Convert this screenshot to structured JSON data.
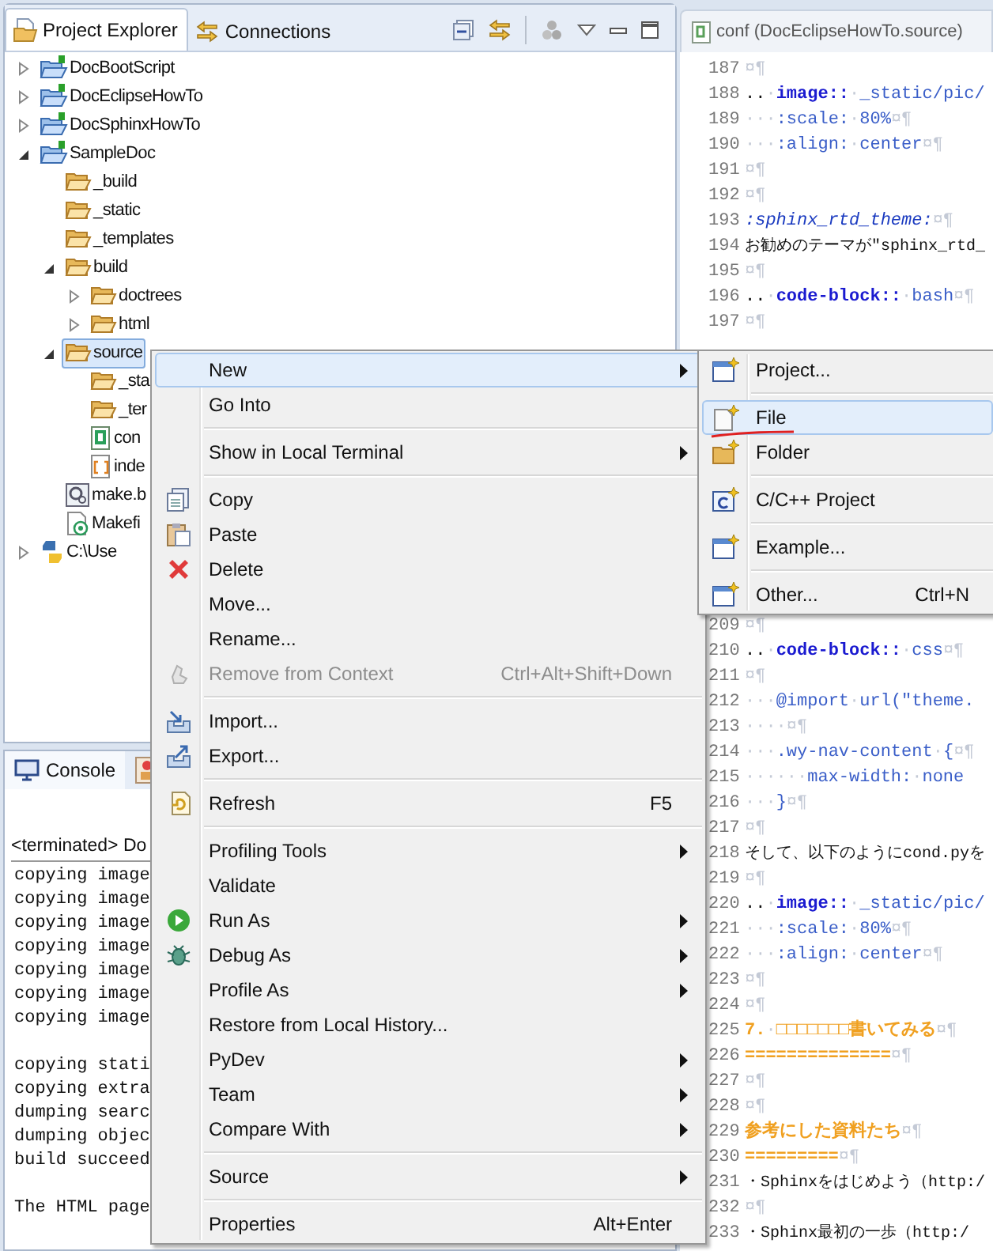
{
  "explorer": {
    "tabs": [
      {
        "label": "Project Explorer",
        "selected": true
      },
      {
        "label": "Connections",
        "selected": false
      }
    ],
    "tree": [
      {
        "label": "DocBootScript",
        "kind": "project",
        "expanded": false,
        "selected": false
      },
      {
        "label": "DocEclipseHowTo",
        "kind": "project",
        "expanded": false,
        "selected": false
      },
      {
        "label": "DocSphinxHowTo",
        "kind": "project",
        "expanded": false,
        "selected": false
      },
      {
        "label": "SampleDoc",
        "kind": "project",
        "expanded": true,
        "selected": false,
        "children": [
          {
            "label": "_build",
            "kind": "folder",
            "selected": false
          },
          {
            "label": "_static",
            "kind": "folder",
            "selected": false
          },
          {
            "label": "_templates",
            "kind": "folder",
            "selected": false
          },
          {
            "label": "build",
            "kind": "folder",
            "expanded": true,
            "selected": false,
            "children": [
              {
                "label": "doctrees",
                "kind": "folder",
                "expanded": false,
                "selected": false
              },
              {
                "label": "html",
                "kind": "folder",
                "expanded": false,
                "selected": false
              }
            ]
          },
          {
            "label": "source",
            "kind": "folder",
            "expanded": true,
            "selected": true,
            "children": [
              {
                "label": "_sta",
                "kind": "folder",
                "selected": false
              },
              {
                "label": "_ter",
                "kind": "folder",
                "selected": false
              },
              {
                "label": "con",
                "kind": "pyfile",
                "selected": false
              },
              {
                "label": "inde",
                "kind": "rstfile",
                "selected": false
              }
            ]
          },
          {
            "label": "make.b",
            "kind": "batfile",
            "selected": false
          },
          {
            "label": "Makefi",
            "kind": "makefile",
            "selected": false
          }
        ]
      },
      {
        "label": "C:\\Use",
        "kind": "python",
        "expanded": false,
        "selected": false
      }
    ]
  },
  "console": {
    "tabs": [
      {
        "label": "Console",
        "selected": true
      }
    ],
    "header": "<terminated> Do",
    "line_groups": [
      [
        "copying image",
        "copying image",
        "copying image",
        "copying image",
        "copying image",
        "copying image",
        "copying image"
      ],
      [
        "copying stati",
        "copying extra",
        "dumping searc",
        "dumping objec",
        "build succeed"
      ],
      [
        "The HTML page"
      ]
    ]
  },
  "editor": {
    "tab": {
      "label": "conf (DocEclipseHowTo.source)"
    },
    "lines_top": [
      {
        "n": "187",
        "parts": [
          {
            "text": "¤¶",
            "kind": "ws"
          }
        ]
      },
      {
        "n": "188",
        "parts": [
          {
            "text": "..",
            "kind": "plain"
          },
          {
            "text": "·",
            "kind": "ws"
          },
          {
            "text": "image::",
            "kind": "directive"
          },
          {
            "text": "·",
            "kind": "ws"
          },
          {
            "text": "_static/pic/",
            "kind": "value"
          }
        ]
      },
      {
        "n": "189",
        "parts": [
          {
            "text": "···",
            "kind": "ws"
          },
          {
            "text": ":scale:",
            "kind": "value"
          },
          {
            "text": "·",
            "kind": "ws"
          },
          {
            "text": "80%",
            "kind": "value"
          },
          {
            "text": "¤¶",
            "kind": "ws"
          }
        ]
      },
      {
        "n": "190",
        "parts": [
          {
            "text": "···",
            "kind": "ws"
          },
          {
            "text": ":align:",
            "kind": "value"
          },
          {
            "text": "·",
            "kind": "ws"
          },
          {
            "text": "center",
            "kind": "value"
          },
          {
            "text": "¤¶",
            "kind": "ws"
          }
        ]
      },
      {
        "n": "191",
        "parts": [
          {
            "text": "¤¶",
            "kind": "ws"
          }
        ]
      },
      {
        "n": "192",
        "parts": [
          {
            "text": "¤¶",
            "kind": "ws"
          }
        ]
      },
      {
        "n": "193",
        "parts": [
          {
            "text": ":sphinx_rtd_theme:",
            "kind": "role"
          },
          {
            "text": "¤¶",
            "kind": "ws"
          }
        ]
      },
      {
        "n": "194",
        "parts": [
          {
            "text": "お勧めのテーマが\"sphinx_rtd_",
            "kind": "prose"
          }
        ]
      },
      {
        "n": "195",
        "parts": [
          {
            "text": "¤¶",
            "kind": "ws"
          }
        ]
      },
      {
        "n": "196",
        "parts": [
          {
            "text": "..",
            "kind": "plain"
          },
          {
            "text": "·",
            "kind": "ws"
          },
          {
            "text": "code-block::",
            "kind": "directive"
          },
          {
            "text": "·",
            "kind": "ws"
          },
          {
            "text": "bash",
            "kind": "value"
          },
          {
            "text": "¤¶",
            "kind": "ws"
          }
        ]
      },
      {
        "n": "197",
        "parts": [
          {
            "text": "¤¶",
            "kind": "ws"
          }
        ]
      }
    ],
    "lines_bottom": [
      {
        "n": "209",
        "parts": [
          {
            "text": "¤¶",
            "kind": "ws"
          }
        ]
      },
      {
        "n": "210",
        "parts": [
          {
            "text": "..",
            "kind": "plain"
          },
          {
            "text": "·",
            "kind": "ws"
          },
          {
            "text": "code-block::",
            "kind": "directive"
          },
          {
            "text": "·",
            "kind": "ws"
          },
          {
            "text": "css",
            "kind": "value"
          },
          {
            "text": "¤¶",
            "kind": "ws"
          }
        ]
      },
      {
        "n": "211",
        "parts": [
          {
            "text": "¤¶",
            "kind": "ws"
          }
        ]
      },
      {
        "n": "212",
        "parts": [
          {
            "text": "···",
            "kind": "ws"
          },
          {
            "text": "@import",
            "kind": "value"
          },
          {
            "text": "·",
            "kind": "ws"
          },
          {
            "text": "url(\"theme.",
            "kind": "value"
          }
        ]
      },
      {
        "n": "213",
        "parts": [
          {
            "text": "····",
            "kind": "ws"
          },
          {
            "text": "¤¶",
            "kind": "ws"
          }
        ]
      },
      {
        "n": "214",
        "parts": [
          {
            "text": "···",
            "kind": "ws"
          },
          {
            "text": ".wy-nav-content",
            "kind": "value"
          },
          {
            "text": "·",
            "kind": "ws"
          },
          {
            "text": "{",
            "kind": "value"
          },
          {
            "text": "¤¶",
            "kind": "ws"
          }
        ]
      },
      {
        "n": "215",
        "parts": [
          {
            "text": "······",
            "kind": "ws"
          },
          {
            "text": "max-width:",
            "kind": "value"
          },
          {
            "text": "·",
            "kind": "ws"
          },
          {
            "text": "none",
            "kind": "value"
          }
        ]
      },
      {
        "n": "216",
        "parts": [
          {
            "text": "···",
            "kind": "ws"
          },
          {
            "text": "}",
            "kind": "value"
          },
          {
            "text": "¤¶",
            "kind": "ws"
          }
        ]
      },
      {
        "n": "217",
        "parts": [
          {
            "text": "¤¶",
            "kind": "ws"
          }
        ]
      },
      {
        "n": "218",
        "parts": [
          {
            "text": "そして、以下のようにcond.pyを",
            "kind": "prose"
          }
        ]
      },
      {
        "n": "219",
        "parts": [
          {
            "text": "¤¶",
            "kind": "ws"
          }
        ]
      },
      {
        "n": "220",
        "parts": [
          {
            "text": "..",
            "kind": "plain"
          },
          {
            "text": "·",
            "kind": "ws"
          },
          {
            "text": "image::",
            "kind": "directive"
          },
          {
            "text": "·",
            "kind": "ws"
          },
          {
            "text": "_static/pic/",
            "kind": "value"
          }
        ]
      },
      {
        "n": "221",
        "parts": [
          {
            "text": "···",
            "kind": "ws"
          },
          {
            "text": ":scale:",
            "kind": "value"
          },
          {
            "text": "·",
            "kind": "ws"
          },
          {
            "text": "80%",
            "kind": "value"
          },
          {
            "text": "¤¶",
            "kind": "ws"
          }
        ]
      },
      {
        "n": "222",
        "parts": [
          {
            "text": "···",
            "kind": "ws"
          },
          {
            "text": ":align:",
            "kind": "value"
          },
          {
            "text": "·",
            "kind": "ws"
          },
          {
            "text": "center",
            "kind": "value"
          },
          {
            "text": "¤¶",
            "kind": "ws"
          }
        ]
      },
      {
        "n": "223",
        "parts": [
          {
            "text": "¤¶",
            "kind": "ws"
          }
        ]
      },
      {
        "n": "224",
        "parts": [
          {
            "text": "¤¶",
            "kind": "ws"
          }
        ]
      },
      {
        "n": "225",
        "parts": [
          {
            "text": "7.",
            "kind": "heading"
          },
          {
            "text": "·",
            "kind": "ws"
          },
          {
            "text": "□□□□□□□書いてみる",
            "kind": "heading"
          },
          {
            "text": "¤¶",
            "kind": "ws"
          }
        ]
      },
      {
        "n": "226",
        "parts": [
          {
            "text": "==============",
            "kind": "heading"
          },
          {
            "text": "¤¶",
            "kind": "ws"
          }
        ]
      },
      {
        "n": "227",
        "parts": [
          {
            "text": "¤¶",
            "kind": "ws"
          }
        ]
      },
      {
        "n": "228",
        "parts": [
          {
            "text": "¤¶",
            "kind": "ws"
          }
        ]
      },
      {
        "n": "229",
        "parts": [
          {
            "text": "参考にした資料たち",
            "kind": "heading"
          },
          {
            "text": "¤¶",
            "kind": "ws"
          }
        ]
      },
      {
        "n": "230",
        "parts": [
          {
            "text": "=========",
            "kind": "heading"
          },
          {
            "text": "¤¶",
            "kind": "ws"
          }
        ]
      },
      {
        "n": "231",
        "parts": [
          {
            "text": "・Sphinxをはじめよう（http:/",
            "kind": "prose"
          }
        ]
      },
      {
        "n": "232",
        "parts": [
          {
            "text": "¤¶",
            "kind": "ws"
          }
        ]
      },
      {
        "n": "233",
        "parts": [
          {
            "text": "・Sphinx最初の一歩（http:/",
            "kind": "prose"
          }
        ]
      }
    ]
  },
  "context_menu": {
    "items": [
      {
        "kind": "item",
        "label": "New",
        "submenu": true,
        "selected": true,
        "disabled": false
      },
      {
        "kind": "item",
        "label": "Go Into",
        "selected": false,
        "disabled": false
      },
      {
        "kind": "separator"
      },
      {
        "kind": "item",
        "label": "Show in Local Terminal",
        "submenu": true,
        "selected": false,
        "disabled": false
      },
      {
        "kind": "separator"
      },
      {
        "kind": "copy",
        "label": "Copy",
        "selected": false,
        "disabled": false
      },
      {
        "kind": "paste",
        "label": "Paste",
        "selected": false,
        "disabled": false
      },
      {
        "kind": "delete",
        "label": "Delete",
        "selected": false,
        "disabled": false
      },
      {
        "kind": "item",
        "label": "Move...",
        "selected": false,
        "disabled": false
      },
      {
        "kind": "item",
        "label": "Rename...",
        "selected": false,
        "disabled": false
      },
      {
        "kind": "remove",
        "label": "Remove from Context",
        "shortcut": "Ctrl+Alt+Shift+Down",
        "selected": false,
        "disabled": true
      },
      {
        "kind": "separator"
      },
      {
        "kind": "import",
        "label": "Import...",
        "selected": false,
        "disabled": false
      },
      {
        "kind": "export",
        "label": "Export...",
        "selected": false,
        "disabled": false
      },
      {
        "kind": "separator"
      },
      {
        "kind": "refresh",
        "label": "Refresh",
        "shortcut": "F5",
        "selected": false,
        "disabled": false
      },
      {
        "kind": "separator"
      },
      {
        "kind": "item",
        "label": "Profiling Tools",
        "submenu": true,
        "selected": false,
        "disabled": false
      },
      {
        "kind": "item",
        "label": "Validate",
        "selected": false,
        "disabled": false
      },
      {
        "kind": "run",
        "label": "Run As",
        "submenu": true,
        "selected": false,
        "disabled": false
      },
      {
        "kind": "debug",
        "label": "Debug As",
        "submenu": true,
        "selected": false,
        "disabled": false
      },
      {
        "kind": "item",
        "label": "Profile As",
        "submenu": true,
        "selected": false,
        "disabled": false
      },
      {
        "kind": "item",
        "label": "Restore from Local History...",
        "selected": false,
        "disabled": false
      },
      {
        "kind": "item",
        "label": "PyDev",
        "submenu": true,
        "selected": false,
        "disabled": false
      },
      {
        "kind": "item",
        "label": "Team",
        "submenu": true,
        "selected": false,
        "disabled": false
      },
      {
        "kind": "item",
        "label": "Compare With",
        "submenu": true,
        "selected": false,
        "disabled": false
      },
      {
        "kind": "separator"
      },
      {
        "kind": "item",
        "label": "Source",
        "submenu": true,
        "selected": false,
        "disabled": false
      },
      {
        "kind": "separator"
      },
      {
        "kind": "item",
        "label": "Properties",
        "shortcut": "Alt+Enter",
        "selected": false,
        "disabled": false
      }
    ]
  },
  "submenu": {
    "items": [
      {
        "kind": "wizard",
        "label": "Project...",
        "selected": false
      },
      {
        "kind": "separator"
      },
      {
        "kind": "file",
        "label": "File",
        "selected": true
      },
      {
        "kind": "folder",
        "label": "Folder",
        "selected": false
      },
      {
        "kind": "separator"
      },
      {
        "kind": "cproject",
        "label": "C/C++ Project",
        "selected": false
      },
      {
        "kind": "separator"
      },
      {
        "kind": "wizard",
        "label": "Example...",
        "selected": false
      },
      {
        "kind": "separator"
      },
      {
        "kind": "wizard",
        "label": "Other...",
        "shortcut": "Ctrl+N",
        "selected": false
      }
    ]
  }
}
